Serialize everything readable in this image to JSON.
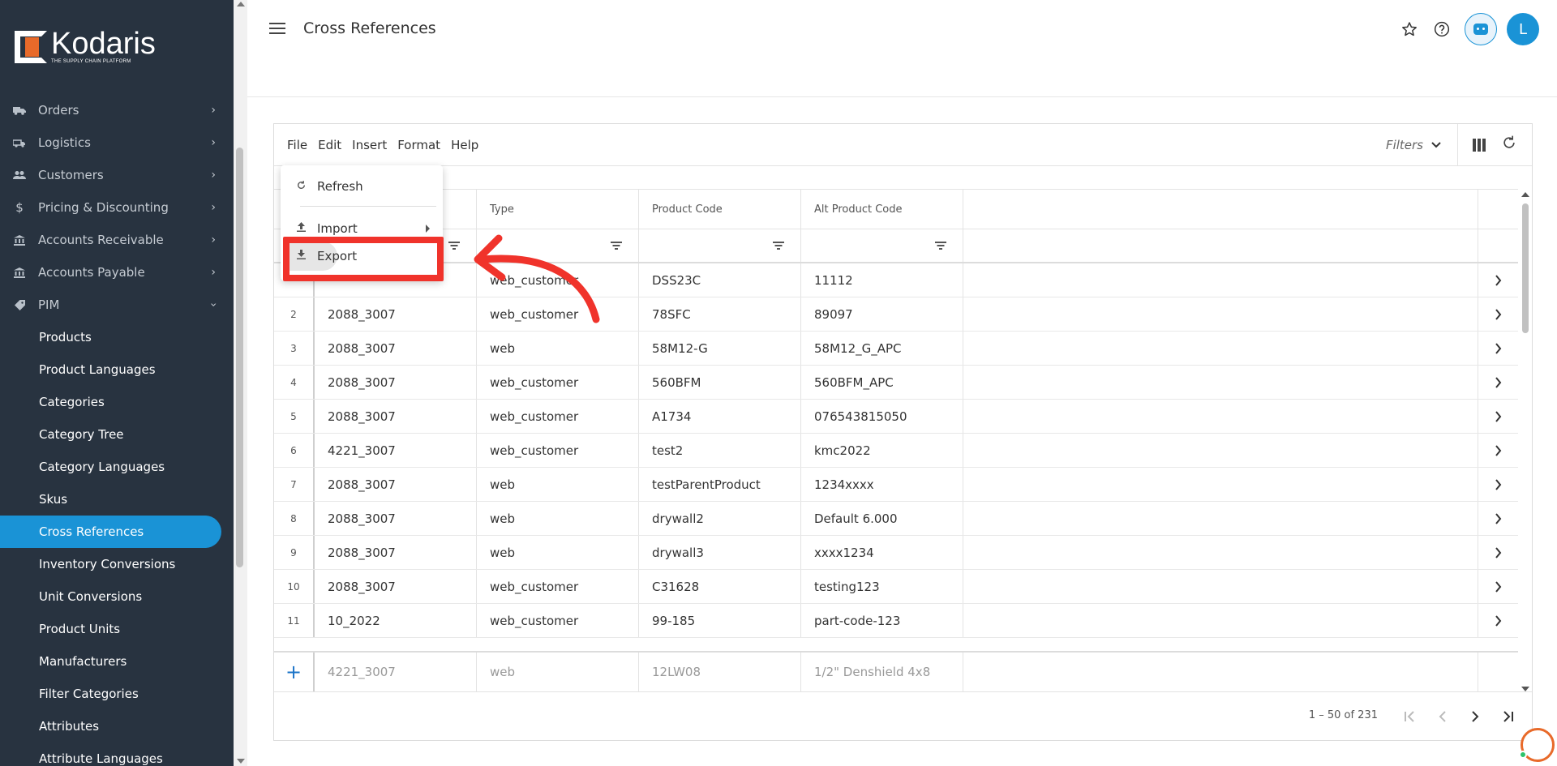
{
  "brand": {
    "name": "Kodaris",
    "tagline": "THE SUPPLY CHAIN PLATFORM",
    "accent": "#1a93d6",
    "logo_orange": "#e86a2a"
  },
  "sidebar": {
    "sections": [
      {
        "label": "Orders",
        "icon": "truck-icon"
      },
      {
        "label": "Logistics",
        "icon": "delivery-truck-icon"
      },
      {
        "label": "Customers",
        "icon": "people-icon"
      },
      {
        "label": "Pricing & Discounting",
        "icon": "dollar-icon"
      },
      {
        "label": "Accounts Receivable",
        "icon": "bank-icon"
      },
      {
        "label": "Accounts Payable",
        "icon": "bank-icon"
      },
      {
        "label": "PIM",
        "icon": "tag-icon"
      }
    ],
    "pim_items": [
      "Products",
      "Product Languages",
      "Categories",
      "Category Tree",
      "Category Languages",
      "Skus",
      "Cross References",
      "Inventory Conversions",
      "Unit Conversions",
      "Product Units",
      "Manufacturers",
      "Filter Categories",
      "Attributes",
      "Attribute Languages"
    ],
    "active_item": "Cross References"
  },
  "header": {
    "title": "Cross References",
    "avatar_initial": "L"
  },
  "toolbar": {
    "menu": [
      "File",
      "Edit",
      "Insert",
      "Format",
      "Help"
    ],
    "filters_label": "Filters"
  },
  "file_menu": {
    "items": [
      {
        "label": "Refresh",
        "icon": "refresh-icon"
      },
      {
        "label": "Import",
        "icon": "upload-icon",
        "has_submenu": true
      },
      {
        "label": "Export",
        "icon": "download-icon"
      }
    ],
    "highlighted": "Export"
  },
  "grid": {
    "columns": [
      "",
      "Type",
      "Product Code",
      "Alt Product Code"
    ],
    "rows": [
      {
        "num": "",
        "c1": "",
        "type": "web_customer",
        "code": "DSS23C",
        "alt": "11112"
      },
      {
        "num": "2",
        "c1": "2088_3007",
        "type": "web_customer",
        "code": "78SFC",
        "alt": "89097"
      },
      {
        "num": "3",
        "c1": "2088_3007",
        "type": "web",
        "code": "58M12-G",
        "alt": "58M12_G_APC"
      },
      {
        "num": "4",
        "c1": "2088_3007",
        "type": "web_customer",
        "code": "560BFM",
        "alt": "560BFM_APC"
      },
      {
        "num": "5",
        "c1": "2088_3007",
        "type": "web_customer",
        "code": "A1734",
        "alt": "076543815050"
      },
      {
        "num": "6",
        "c1": "4221_3007",
        "type": "web_customer",
        "code": "test2",
        "alt": "kmc2022"
      },
      {
        "num": "7",
        "c1": "2088_3007",
        "type": "web",
        "code": "testParentProduct",
        "alt": "1234xxxx"
      },
      {
        "num": "8",
        "c1": "2088_3007",
        "type": "web",
        "code": "drywall2",
        "alt": "Default 6.000"
      },
      {
        "num": "9",
        "c1": "2088_3007",
        "type": "web",
        "code": "drywall3",
        "alt": "xxxx1234"
      },
      {
        "num": "10",
        "c1": "2088_3007",
        "type": "web_customer",
        "code": "C31628",
        "alt": "testing123"
      },
      {
        "num": "11",
        "c1": "10_2022",
        "type": "web_customer",
        "code": "99-185",
        "alt": "part-code-123"
      }
    ],
    "new_row": {
      "c1": "4221_3007",
      "type": "web",
      "code": "12LW08",
      "alt": "1/2\" Denshield 4x8"
    }
  },
  "paginator": {
    "range": "1 – 50 of 231"
  },
  "annotation": {
    "color": "#f0332b"
  }
}
